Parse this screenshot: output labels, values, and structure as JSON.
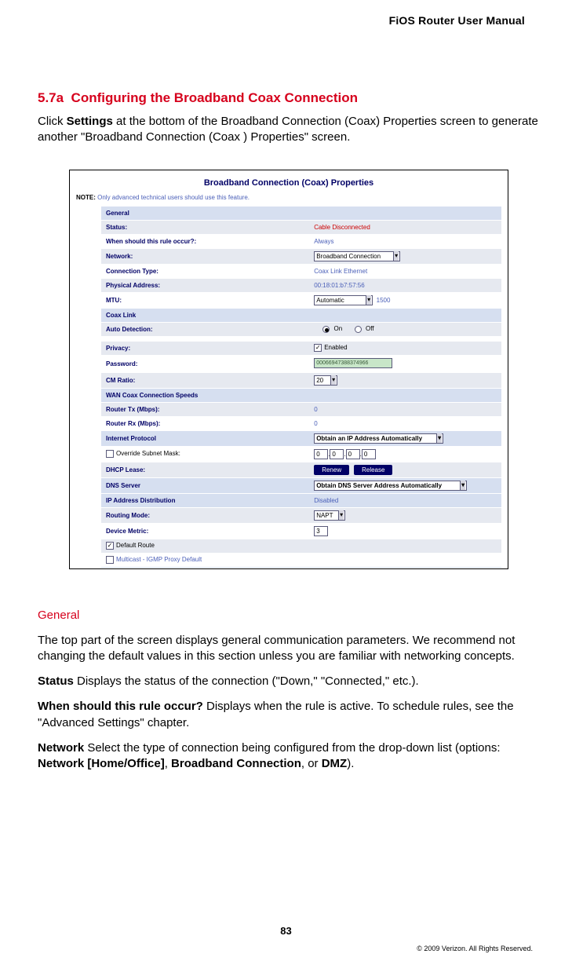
{
  "header": "FiOS Router User Manual",
  "section_num": "5.7a",
  "section_title": "Configuring the Broadband Coax Connection",
  "intro_1a": "Click ",
  "intro_1b": "Settings",
  "intro_1c": " at the bottom of the Broadband Connection (Coax) Properties screen to generate another \"Broadband Connection (Coax ) Properties\" screen.",
  "shot": {
    "title": "Broadband Connection (Coax) Properties",
    "note_lbl": "NOTE:",
    "note_txt": " Only advanced technical users should use this feature.",
    "general_h": "General",
    "status_l": "Status:",
    "status_v": "Cable Disconnected",
    "rule_l": "When should this rule occur?:",
    "rule_v": "Always",
    "network_l": "Network:",
    "network_v": "Broadband Connection",
    "conn_l": "Connection Type:",
    "conn_v": "Coax Link Ethernet",
    "phys_l": "Physical Address:",
    "phys_v": "00:18:01:b7:57:56",
    "mtu_l": "MTU:",
    "mtu_v": "Automatic",
    "mtu_num": "1500",
    "coax_h": "Coax Link",
    "auto_l": "Auto Detection:",
    "on": "On",
    "off": "Off",
    "priv_l": "Privacy:",
    "priv_v": "Enabled",
    "pass_l": "Password:",
    "pass_v": "00066947388374966",
    "cm_l": "CM Ratio:",
    "cm_v": "20",
    "wan_h": "WAN Coax Connection Speeds",
    "tx_l": "Router Tx (Mbps):",
    "tx_v": "0",
    "rx_l": "Router Rx (Mbps):",
    "rx_v": "0",
    "ip_h": "Internet Protocol",
    "ip_v": "Obtain an IP Address Automatically",
    "override_l": "Override Subnet Mask:",
    "oct": "0",
    "dhcp_l": "DHCP Lease:",
    "renew": "Renew",
    "release": "Release",
    "dns_h": "DNS Server",
    "dns_v": "Obtain DNS Server Address Automatically",
    "ipdist_h": "IP Address Distribution",
    "ipdist_v": "Disabled",
    "routing_l": "Routing Mode:",
    "routing_v": "NAPT",
    "metric_l": "Device Metric:",
    "metric_v": "3",
    "defroute": "Default Route",
    "igmp": "Multicast - IGMP Proxy Default"
  },
  "general_h": "General",
  "general_p": "The top part of the screen displays general communication parameters. We recommend not changing the default values in this section unless you are familiar with networking concepts.",
  "status_b": "Status",
  "status_t": "  Displays the status of the connection (\"Down,\" \"Connected,\" etc.).",
  "when_b": "When should this rule occur?",
  "when_t": "  Displays when the rule is active. To schedule rules, see the \"Advanced Settings\" chapter.",
  "net_b": "Network",
  "net_t1": "  Select the type of connection being configured from the drop-down list (options: ",
  "net_t2": "Network [Home/Office]",
  "net_t3": ", ",
  "net_t4": "Broadband Connection",
  "net_t5": ", or ",
  "net_t6": "DMZ",
  "net_t7": ").",
  "page_num": "83",
  "copyright": "© 2009 Verizon. All Rights Reserved."
}
